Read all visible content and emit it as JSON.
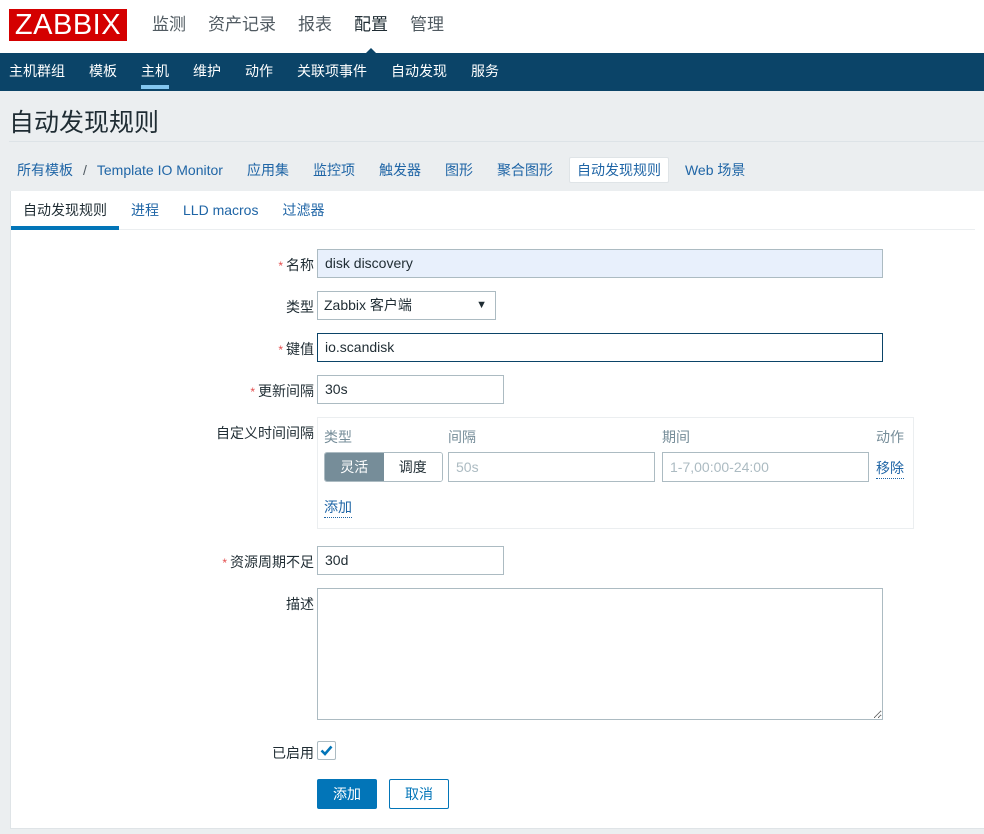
{
  "header": {
    "logo": "ZABBIX",
    "main_menu": [
      {
        "label": "监测",
        "active": false
      },
      {
        "label": "资产记录",
        "active": false
      },
      {
        "label": "报表",
        "active": false
      },
      {
        "label": "配置",
        "active": true
      },
      {
        "label": "管理",
        "active": false
      }
    ],
    "sub_menu": [
      {
        "label": "主机群组",
        "active": false
      },
      {
        "label": "模板",
        "active": false
      },
      {
        "label": "主机",
        "active": true
      },
      {
        "label": "维护",
        "active": false
      },
      {
        "label": "动作",
        "active": false
      },
      {
        "label": "关联项事件",
        "active": false
      },
      {
        "label": "自动发现",
        "active": false
      },
      {
        "label": "服务",
        "active": false
      }
    ]
  },
  "page": {
    "title": "自动发现规则"
  },
  "breadcrumbs": {
    "root": "所有模板",
    "separator": "/",
    "template": "Template IO Monitor",
    "links": [
      {
        "label": "应用集",
        "selected": false
      },
      {
        "label": "监控项",
        "selected": false
      },
      {
        "label": "触发器",
        "selected": false
      },
      {
        "label": "图形",
        "selected": false
      },
      {
        "label": "聚合图形",
        "selected": false
      },
      {
        "label": "自动发现规则",
        "selected": true
      },
      {
        "label": "Web 场景",
        "selected": false
      }
    ]
  },
  "tabs": [
    {
      "label": "自动发现规则",
      "active": true
    },
    {
      "label": "进程",
      "active": false
    },
    {
      "label": "LLD macros",
      "active": false
    },
    {
      "label": "过滤器",
      "active": false
    }
  ],
  "form": {
    "required_mark": "*",
    "name": {
      "label": "名称",
      "value": "disk discovery"
    },
    "type": {
      "label": "类型",
      "value": "Zabbix 客户端",
      "arrow": "▼"
    },
    "key": {
      "label": "键值",
      "value": "io.scandisk"
    },
    "update_interval": {
      "label": "更新间隔",
      "value": "30s"
    },
    "custom_intervals": {
      "label": "自定义时间间隔",
      "columns": {
        "type": "类型",
        "interval": "间隔",
        "period": "期间",
        "action": "动作"
      },
      "rows": [
        {
          "type_options": [
            "灵活",
            "调度"
          ],
          "type_selected": "灵活",
          "interval_placeholder": "50s",
          "period_placeholder": "1-7,00:00-24:00",
          "remove_label": "移除"
        }
      ],
      "add_label": "添加"
    },
    "keep_lost": {
      "label": "资源周期不足",
      "value": "30d"
    },
    "description": {
      "label": "描述",
      "value": ""
    },
    "enabled": {
      "label": "已启用",
      "checked": true
    },
    "buttons": {
      "add": "添加",
      "cancel": "取消"
    }
  },
  "colors": {
    "brand_red": "#d40000",
    "nav_blue": "#0b4468",
    "accent": "#0275b8",
    "link": "#1f65a6",
    "required": "#e44e4e"
  }
}
